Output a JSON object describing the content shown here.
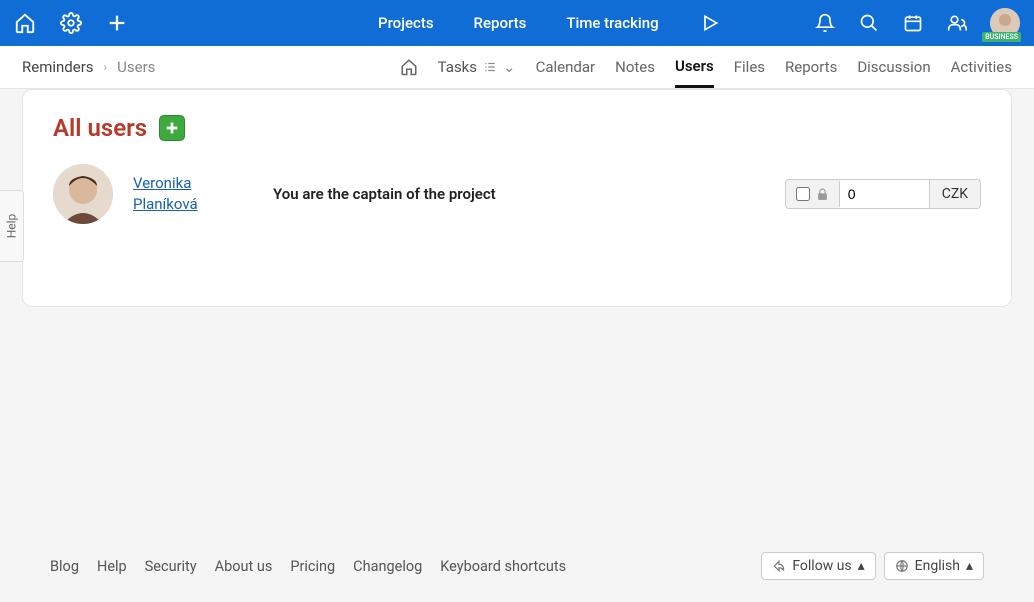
{
  "top_nav": {
    "projects": "Projects",
    "reports": "Reports",
    "time_tracking": "Time tracking"
  },
  "breadcrumb": {
    "parent": "Reminders",
    "current": "Users"
  },
  "tabs": {
    "tasks": "Tasks",
    "calendar": "Calendar",
    "notes": "Notes",
    "users": "Users",
    "files": "Files",
    "reports": "Reports",
    "discussion": "Discussion",
    "activities": "Activities"
  },
  "page_title": "All users",
  "user": {
    "name": "Veronika Planíková",
    "caption": "You are the captain of the project",
    "rate_value": "0",
    "currency": "CZK"
  },
  "footer": {
    "blog": "Blog",
    "help": "Help",
    "security": "Security",
    "about": "About us",
    "pricing": "Pricing",
    "changelog": "Changelog",
    "shortcuts": "Keyboard shortcuts",
    "follow": "Follow us",
    "language": "English"
  },
  "help_tab": "Help",
  "badge": "BUSINESS"
}
